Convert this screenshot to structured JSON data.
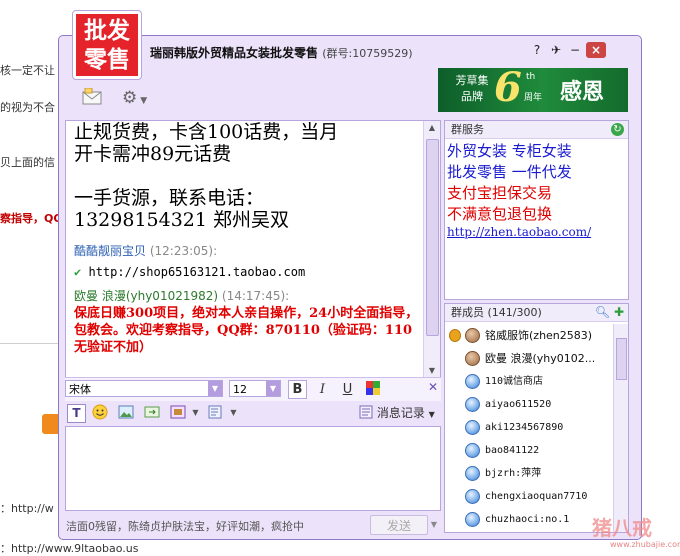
{
  "background": {
    "fragments": [
      "核一定不让",
      "的视为不合",
      "贝上面的信",
      "察指导，QQ",
      "：http://w",
      "：http://www.9ltaobao.us"
    ]
  },
  "window": {
    "logo": {
      "line1": "批发",
      "line2": "零售"
    },
    "title": "瑞丽韩版外贸精品女装批发零售",
    "group_id": "(群号:10759529)",
    "buttons": {
      "help": "?",
      "pin": "✈",
      "minimize": "−",
      "close": "×"
    }
  },
  "banner": {
    "left": "芳草集\n品牌",
    "six": "6",
    "th": "th",
    "zhou": "周年",
    "text": "感恩"
  },
  "chat": {
    "lines": [
      "止规货费，卡含100话费，当月",
      "开卡需冲89元话费",
      "一手货源，联系电话：",
      "13298154321        郑州吴双"
    ],
    "messages": [
      {
        "sender": "酷酷靓丽宝贝",
        "time": "(12:23:05):",
        "body": "http://shop65163121.taobao.com"
      },
      {
        "sender": "欧曼 浪漫(yhy01021982)",
        "time": "(14:17:45):",
        "body": "保底日赚300项目，绝对本人亲自操作，24小时全面指导，包教会。欢迎考察指导，QQ群：870110（验证码：110 无验证不加）"
      }
    ]
  },
  "format": {
    "font": "宋体",
    "size": "12",
    "bold": "B",
    "italic": "I",
    "underline": "U"
  },
  "toolbar": {
    "history": "消息记录"
  },
  "status": {
    "text": "洁面0残留，陈绮贞护肤法宝，好评如潮，疯抢中",
    "send": "发送"
  },
  "service": {
    "title": "群服务",
    "lines": [
      {
        "text": "外贸女装  专柜女装",
        "color": "#1a1ad0"
      },
      {
        "text": "批发零售  一件代发",
        "color": "#1a1ad0"
      },
      {
        "text": "支付宝担保交易",
        "color": "#e00000"
      },
      {
        "text": "不满意包退包换",
        "color": "#e00000"
      }
    ],
    "link": "http://zhen.taobao.com/"
  },
  "members": {
    "title": "群成员 (141/300)",
    "list": [
      {
        "name": "铭威服饰(zhen2583)",
        "medal": true,
        "photo": true
      },
      {
        "name": "欧曼 浪漫(yhy0102...",
        "medal": false,
        "photo": true
      },
      {
        "name": "110诚信商店",
        "medal": false,
        "photo": false
      },
      {
        "name": "aiyao611520",
        "medal": false,
        "photo": false
      },
      {
        "name": "aki1234567890",
        "medal": false,
        "photo": false
      },
      {
        "name": "bao841122",
        "medal": false,
        "photo": false
      },
      {
        "name": "bjzrh:萍萍",
        "medal": false,
        "photo": false
      },
      {
        "name": "chengxiaoquan7710",
        "medal": false,
        "photo": false
      },
      {
        "name": "chuzhaoci:no.1",
        "medal": false,
        "photo": false
      }
    ]
  },
  "watermark": {
    "text": "猪八戒",
    "sub": "www.zhubajie.com"
  }
}
